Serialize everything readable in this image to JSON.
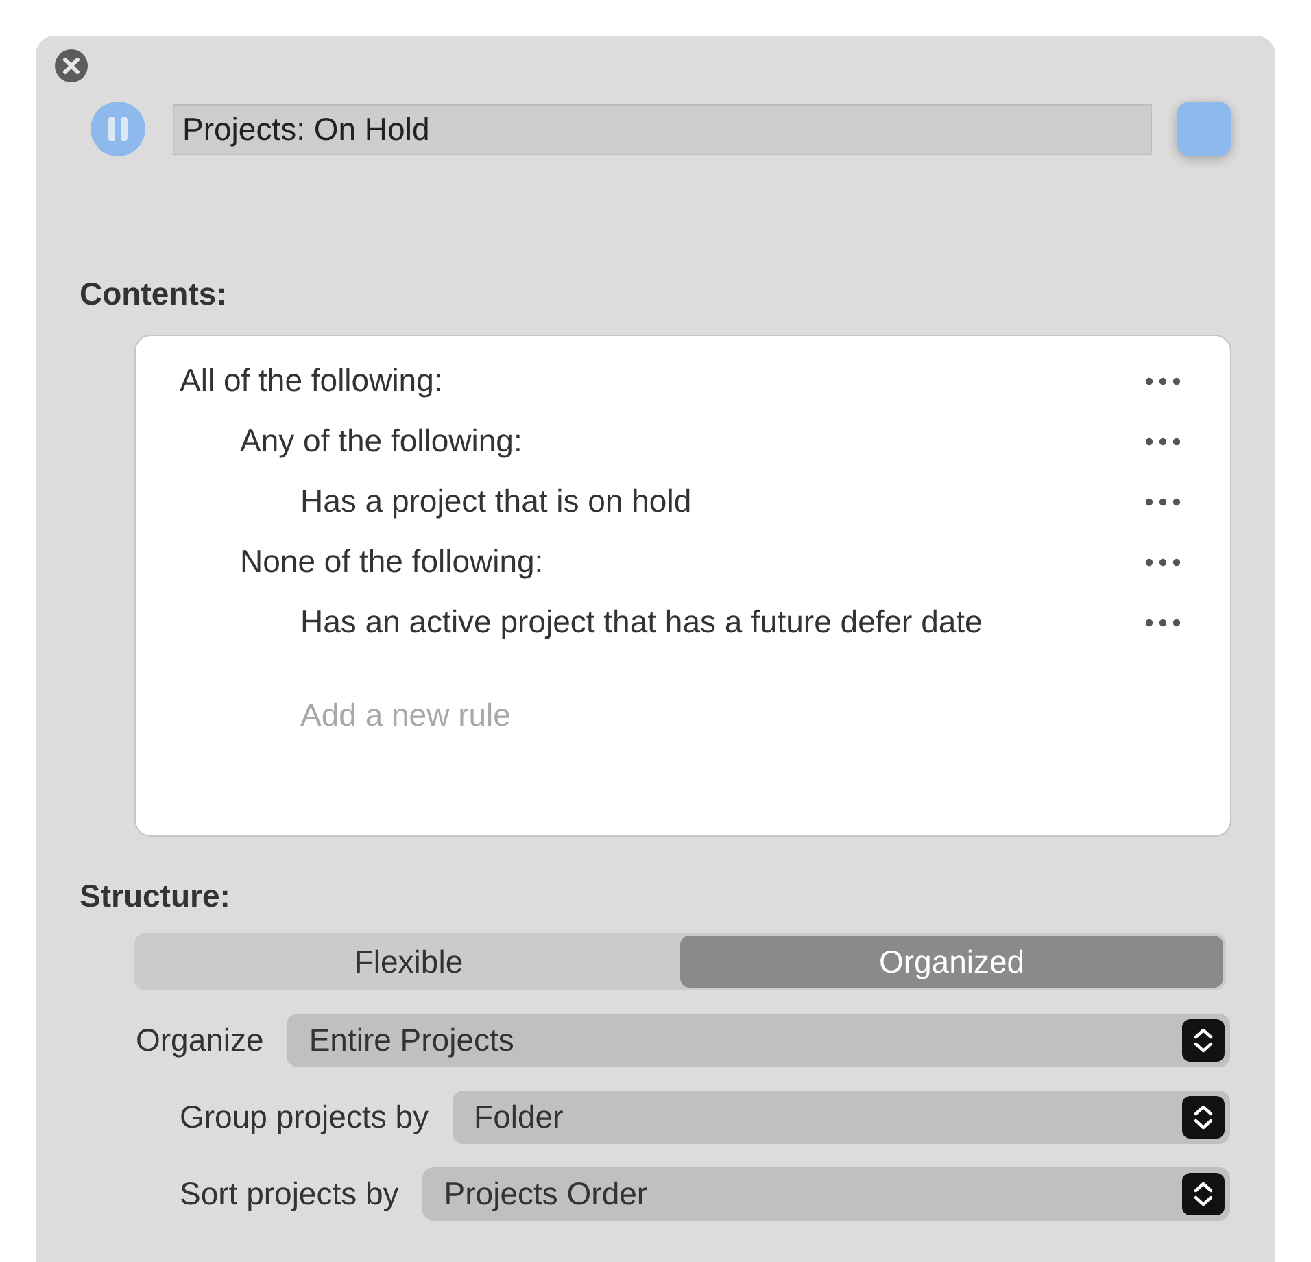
{
  "title_field": {
    "value": "Projects: On Hold"
  },
  "contents": {
    "label": "Contents:",
    "rules": [
      {
        "text": "All of the following:",
        "children": [
          {
            "text": "Any of the following:",
            "children": [
              {
                "text": "Has a project that is on hold"
              }
            ]
          },
          {
            "text": "None of the following:",
            "children": [
              {
                "text": "Has an active project that has a future defer date"
              }
            ]
          }
        ]
      }
    ],
    "add_placeholder": "Add a new rule"
  },
  "structure": {
    "label": "Structure:",
    "segments": [
      {
        "label": "Flexible",
        "selected": false
      },
      {
        "label": "Organized",
        "selected": true
      }
    ],
    "options": [
      {
        "label": "Organize",
        "value": "Entire Projects",
        "children": [
          {
            "label": "Group projects by",
            "value": "Folder"
          },
          {
            "label": "Sort projects by",
            "value": "Projects Order"
          }
        ]
      }
    ]
  }
}
